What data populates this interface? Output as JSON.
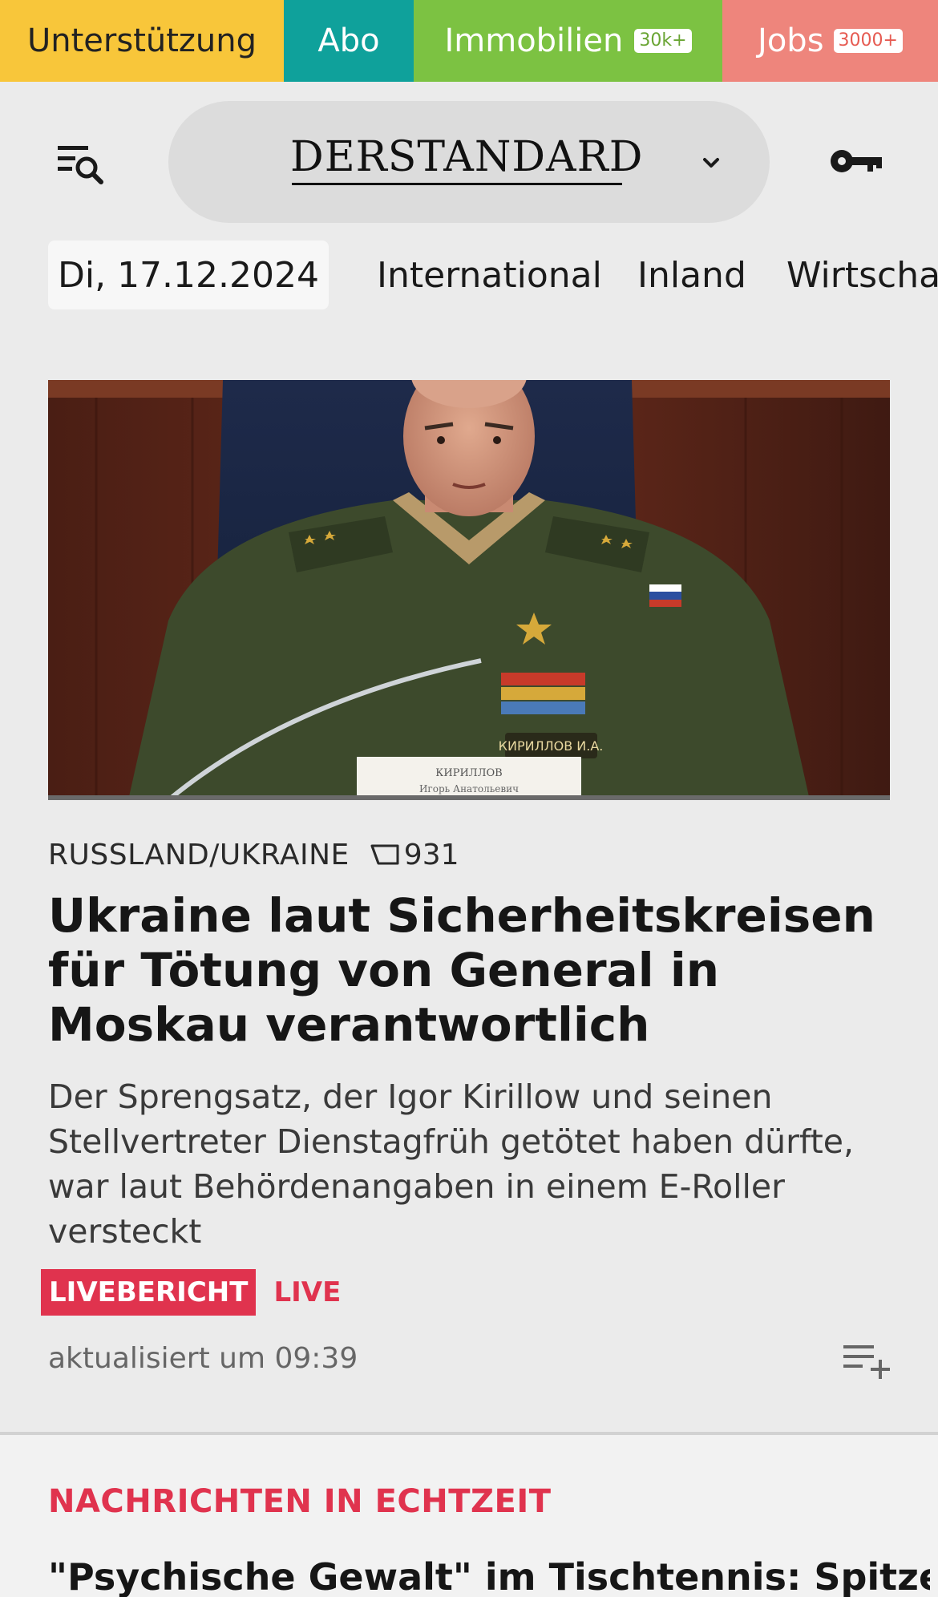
{
  "topbar": {
    "support": "Unterstützung",
    "abo": "Abo",
    "immobilien": "Immobilien",
    "immobilien_badge": "30k+",
    "jobs": "Jobs",
    "jobs_badge": "3000+"
  },
  "header": {
    "logo": "DerStandard",
    "menu_icon": "menu-search-icon",
    "dropdown_icon": "chevron-down-icon",
    "login_icon": "key-icon"
  },
  "nav": {
    "date": "Di, 17.12.2024",
    "links": [
      "International",
      "Inland",
      "Wirtschaft"
    ]
  },
  "article": {
    "kicker": "RUSSLAND/UKRAINE",
    "comment_count": "931",
    "headline": "Ukraine laut Sicherheitskreisen für Tötung von General in Moskau verantwortlich",
    "teaser": "Der Sprengsatz, der Igor Kirillow und seinen Stellvertreter Dienstagfrüh getötet haben dürfte, war laut Behördenangaben in einem E-Roller versteckt",
    "live_badge": "LIVEBERICHT",
    "live_label": "LIVE",
    "updated": "aktualisiert um 09:39",
    "image_nameplate_line1": "КИРИЛЛОВ",
    "image_nameplate_line2": "Игорь Анатольевич",
    "image_patch": "КИРИЛЛОВ И.А."
  },
  "section": {
    "title": "NACHRICHTEN IN ECHTZEIT",
    "next_headline": "\"Psychische Gewalt\" im Tischtennis: Spitzenfunk-"
  },
  "colors": {
    "support": "#f8c63a",
    "abo": "#0fa19b",
    "immobilien": "#7cc242",
    "jobs": "#ee857c",
    "live_red": "#e0334e"
  }
}
